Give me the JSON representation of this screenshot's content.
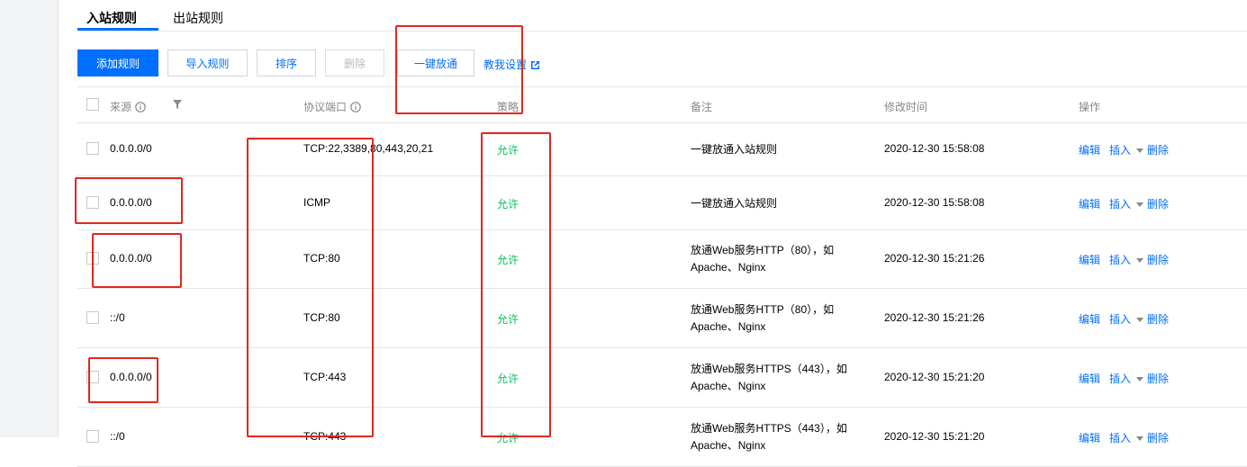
{
  "tabs": [
    {
      "label": "入站规则",
      "active": true
    },
    {
      "label": "出站规则",
      "active": false
    }
  ],
  "toolbar": {
    "add": "添加规则",
    "import": "导入规则",
    "sort": "排序",
    "delete": "删除",
    "one_click": "一键放通",
    "help": "教我设置"
  },
  "columns": {
    "source": "来源",
    "port": "协议端口",
    "policy": "策略",
    "note": "备注",
    "modified": "修改时间",
    "ops": "操作"
  },
  "ops": {
    "edit": "编辑",
    "insert": "插入",
    "delete": "删除"
  },
  "rows": [
    {
      "source": "0.0.0.0/0",
      "port": "TCP:22,3389,80,443,20,21",
      "policy": "允许",
      "note": "一键放通入站规则",
      "modified": "2020-12-30 15:58:08"
    },
    {
      "source": "0.0.0.0/0",
      "port": "ICMP",
      "policy": "允许",
      "note": "一键放通入站规则",
      "modified": "2020-12-30 15:58:08"
    },
    {
      "source": "0.0.0.0/0",
      "port": "TCP:80",
      "policy": "允许",
      "note": "放通Web服务HTTP（80），如Apache、Nginx",
      "modified": "2020-12-30 15:21:26"
    },
    {
      "source": "::/0",
      "port": "TCP:80",
      "policy": "允许",
      "note": "放通Web服务HTTP（80），如Apache、Nginx",
      "modified": "2020-12-30 15:21:26"
    },
    {
      "source": "0.0.0.0/0",
      "port": "TCP:443",
      "policy": "允许",
      "note": "放通Web服务HTTPS（443），如Apache、Nginx",
      "modified": "2020-12-30 15:21:20"
    },
    {
      "source": "::/0",
      "port": "TCP:443",
      "policy": "允许",
      "note": "放通Web服务HTTPS（443），如Apache、Nginx",
      "modified": "2020-12-30 15:21:20"
    }
  ],
  "colors": {
    "accent": "#006eff",
    "allow": "#0abf5b",
    "annotation": "#e0281e"
  },
  "icons": [
    "info-icon",
    "filter-icon",
    "external-link-icon",
    "caret-down-icon"
  ]
}
